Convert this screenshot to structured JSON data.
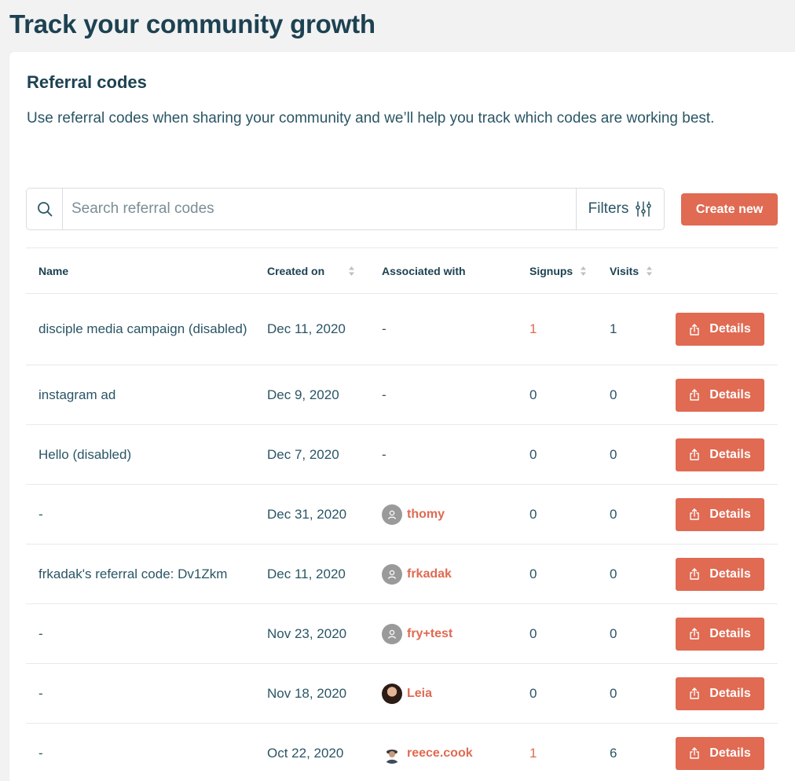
{
  "page": {
    "title": "Track your community growth"
  },
  "section": {
    "title": "Referral codes",
    "description": "Use referral codes when sharing your community and we’ll help you track which codes are working best."
  },
  "search": {
    "placeholder": "Search referral codes",
    "value": ""
  },
  "filters": {
    "label": "Filters"
  },
  "create_button": {
    "label": "Create new"
  },
  "table": {
    "headers": {
      "name": "Name",
      "created": "Created on",
      "associated": "Associated with",
      "signups": "Signups",
      "visits": "Visits"
    },
    "details_label": "Details",
    "rows": [
      {
        "name": "disciple media campaign (disabled)",
        "created": "Dec 11, 2020",
        "associated": "-",
        "avatar": "",
        "signups": "1",
        "visits": "1"
      },
      {
        "name": "instagram ad",
        "created": "Dec 9, 2020",
        "associated": "-",
        "avatar": "",
        "signups": "0",
        "visits": "0"
      },
      {
        "name": "Hello (disabled)",
        "created": "Dec 7, 2020",
        "associated": "-",
        "avatar": "",
        "signups": "0",
        "visits": "0"
      },
      {
        "name": "-",
        "created": "Dec 31, 2020",
        "associated": "thomy",
        "avatar": "default",
        "signups": "0",
        "visits": "0"
      },
      {
        "name": "frkadak's referral code: Dv1Zkm",
        "created": "Dec 11, 2020",
        "associated": "frkadak",
        "avatar": "default",
        "signups": "0",
        "visits": "0"
      },
      {
        "name": "-",
        "created": "Nov 23, 2020",
        "associated": "fry+test",
        "avatar": "default",
        "signups": "0",
        "visits": "0"
      },
      {
        "name": "-",
        "created": "Nov 18, 2020",
        "associated": "Leia",
        "avatar": "photo-leia",
        "signups": "0",
        "visits": "0"
      },
      {
        "name": "-",
        "created": "Oct 22, 2020",
        "associated": "reece.cook",
        "avatar": "photo-reece",
        "signups": "1",
        "visits": "6"
      }
    ]
  },
  "colors": {
    "accent": "#e06a52",
    "heading": "#1d4252",
    "text": "#2a5565",
    "background": "#f2f2f2"
  },
  "icons": {
    "search": "search-icon",
    "filters": "sliders-icon",
    "sort": "sort-icon",
    "details": "share-icon",
    "avatar": "user-avatar-icon"
  }
}
